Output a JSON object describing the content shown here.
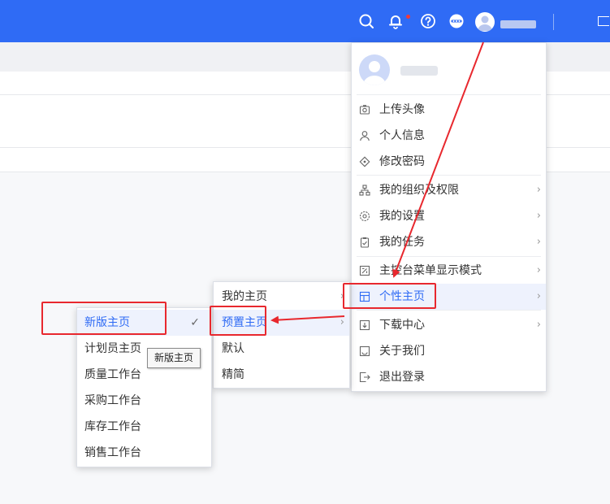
{
  "header": {
    "icons": [
      "search-icon",
      "bell-icon",
      "help-icon",
      "more-icon",
      "user-avatar",
      "window-icon"
    ],
    "accent_color": "#2f6bf5",
    "notification_dot_color": "#f23a3a"
  },
  "user_menu": {
    "items": [
      {
        "label": "上传头像",
        "icon": "upload-avatar-icon"
      },
      {
        "label": "个人信息",
        "icon": "user-icon"
      },
      {
        "label": "修改密码",
        "icon": "lock-icon"
      },
      {
        "label": "我的组织及权限",
        "icon": "org-icon"
      },
      {
        "label": "我的设置",
        "icon": "gear-icon"
      },
      {
        "label": "我的任务",
        "icon": "task-icon"
      },
      {
        "label": "主控台菜单显示模式",
        "icon": "display-mode-icon"
      },
      {
        "label": "个性主页",
        "icon": "homepage-icon"
      },
      {
        "label": "下载中心",
        "icon": "download-icon"
      },
      {
        "label": "关于我们",
        "icon": "about-icon"
      },
      {
        "label": "退出登录",
        "icon": "logout-icon"
      }
    ],
    "chevron": "›"
  },
  "homepage_menu": {
    "items": [
      "我的主页",
      "预置主页",
      "默认",
      "精简"
    ],
    "chevron": "›"
  },
  "preset_menu": {
    "items": [
      "新版主页",
      "计划员主页",
      "质量工作台",
      "采购工作台",
      "库存工作台",
      "销售工作台"
    ],
    "selected_check": "✓"
  },
  "tooltip": {
    "text": "新版主页"
  },
  "annotation_color": "#e8282e"
}
